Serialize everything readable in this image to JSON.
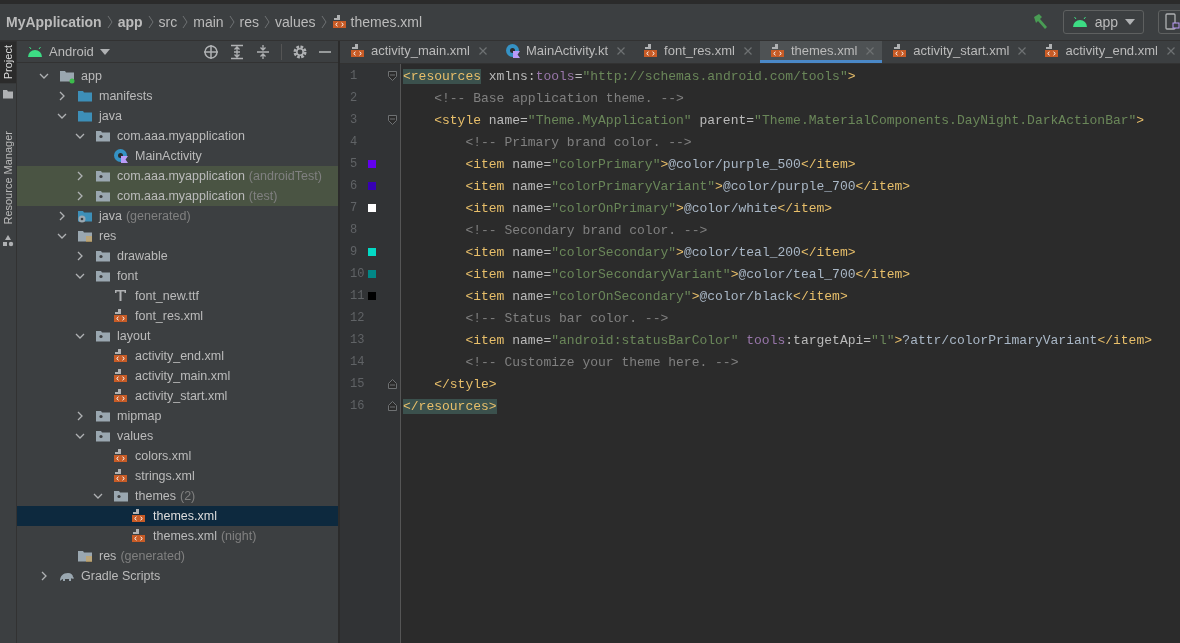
{
  "breadcrumb": [
    {
      "label": "MyApplication",
      "kind": "bold"
    },
    {
      "label": "app",
      "kind": "bold"
    },
    {
      "label": "src",
      "kind": "plain"
    },
    {
      "label": "main",
      "kind": "plain"
    },
    {
      "label": "res",
      "kind": "plain"
    },
    {
      "label": "values",
      "kind": "plain"
    },
    {
      "label": "themes.xml",
      "kind": "xml"
    }
  ],
  "run_config": {
    "label": "app"
  },
  "tool_strip": [
    {
      "label": "Project",
      "selected": true
    },
    {
      "label": "Resource Manager",
      "selected": false
    }
  ],
  "project_panel": {
    "view": "Android",
    "tree": [
      {
        "label": "app",
        "kind": "module",
        "expanded": true,
        "selected": false,
        "highlighted": false,
        "children": [
          {
            "label": "manifests",
            "kind": "folder",
            "expanded": false,
            "selected": false,
            "highlighted": false
          },
          {
            "label": "java",
            "kind": "folder",
            "expanded": true,
            "selected": false,
            "highlighted": false,
            "children": [
              {
                "label": "com.aaa.myapplication",
                "kind": "package",
                "expanded": true,
                "selected": false,
                "highlighted": false,
                "children": [
                  {
                    "label": "MainActivity",
                    "kind": "kotlin",
                    "selected": false,
                    "highlighted": false
                  }
                ]
              },
              {
                "label": "com.aaa.myapplication",
                "note": "(androidTest)",
                "kind": "package",
                "expanded": false,
                "selected": false,
                "highlighted": true
              },
              {
                "label": "com.aaa.myapplication",
                "note": "(test)",
                "kind": "package",
                "expanded": false,
                "selected": false,
                "highlighted": true
              }
            ]
          },
          {
            "label": "java",
            "note": "(generated)",
            "kind": "generated",
            "expanded": false,
            "selected": false,
            "highlighted": false
          },
          {
            "label": "res",
            "kind": "res",
            "expanded": true,
            "selected": false,
            "highlighted": false,
            "children": [
              {
                "label": "drawable",
                "kind": "package",
                "expanded": false,
                "selected": false,
                "highlighted": false
              },
              {
                "label": "font",
                "kind": "package",
                "expanded": true,
                "selected": false,
                "highlighted": false,
                "children": [
                  {
                    "label": "font_new.ttf",
                    "kind": "font",
                    "selected": false,
                    "highlighted": false
                  },
                  {
                    "label": "font_res.xml",
                    "kind": "xml",
                    "selected": false,
                    "highlighted": false
                  }
                ]
              },
              {
                "label": "layout",
                "kind": "package",
                "expanded": true,
                "selected": false,
                "highlighted": false,
                "children": [
                  {
                    "label": "activity_end.xml",
                    "kind": "xml",
                    "selected": false,
                    "highlighted": false
                  },
                  {
                    "label": "activity_main.xml",
                    "kind": "xml",
                    "selected": false,
                    "highlighted": false
                  },
                  {
                    "label": "activity_start.xml",
                    "kind": "xml",
                    "selected": false,
                    "highlighted": false
                  }
                ]
              },
              {
                "label": "mipmap",
                "kind": "package",
                "expanded": false,
                "selected": false,
                "highlighted": false
              },
              {
                "label": "values",
                "kind": "package",
                "expanded": true,
                "selected": false,
                "highlighted": false,
                "children": [
                  {
                    "label": "colors.xml",
                    "kind": "xml",
                    "selected": false,
                    "highlighted": false
                  },
                  {
                    "label": "strings.xml",
                    "kind": "xml",
                    "selected": false,
                    "highlighted": false
                  },
                  {
                    "label": "themes",
                    "note": "(2)",
                    "kind": "package",
                    "expanded": true,
                    "selected": false,
                    "highlighted": false,
                    "children": [
                      {
                        "label": "themes.xml",
                        "kind": "xml",
                        "selected": true,
                        "highlighted": false
                      },
                      {
                        "label": "themes.xml",
                        "note": "(night)",
                        "kind": "xml",
                        "selected": false,
                        "highlighted": false
                      }
                    ]
                  }
                ]
              }
            ]
          },
          {
            "label": "res",
            "note": "(generated)",
            "kind": "res",
            "selected": false,
            "highlighted": false
          }
        ]
      },
      {
        "label": "Gradle Scripts",
        "kind": "gradle",
        "expanded": false,
        "selected": false,
        "highlighted": false
      }
    ]
  },
  "editor": {
    "tabs": [
      {
        "label": "activity_main.xml",
        "kind": "xml",
        "selected": false
      },
      {
        "label": "MainActivity.kt",
        "kind": "kotlin",
        "selected": false
      },
      {
        "label": "font_res.xml",
        "kind": "xml",
        "selected": false
      },
      {
        "label": "themes.xml",
        "kind": "xml",
        "selected": true
      },
      {
        "label": "activity_start.xml",
        "kind": "xml",
        "selected": false
      },
      {
        "label": "activity_end.xml",
        "kind": "xml",
        "selected": false
      }
    ],
    "lines": [
      {
        "number": "1",
        "fold_start": true,
        "tokens": [
          {
            "kind": "match",
            "text": "<resources"
          },
          {
            "kind": "attr",
            "text": " xmlns:"
          },
          {
            "kind": "ns",
            "text": "tools"
          },
          {
            "kind": "attr",
            "text": "="
          },
          {
            "kind": "value",
            "text": "\"http://schemas.android.com/tools\""
          },
          {
            "kind": "tag",
            "text": ">"
          }
        ]
      },
      {
        "number": "2",
        "tokens": [
          {
            "kind": "comment",
            "text": "    <!-- Base application theme. -->"
          }
        ]
      },
      {
        "number": "3",
        "fold_start": true,
        "tokens": [
          {
            "kind": "tag",
            "text": "    <style"
          },
          {
            "kind": "attr",
            "text": " name="
          },
          {
            "kind": "value",
            "text": "\"Theme.MyApplication\""
          },
          {
            "kind": "attr",
            "text": " parent="
          },
          {
            "kind": "value",
            "text": "\"Theme.MaterialComponents.DayNight.DarkActionBar\""
          },
          {
            "kind": "tag",
            "text": ">"
          }
        ]
      },
      {
        "number": "4",
        "tokens": [
          {
            "kind": "comment",
            "text": "        <!-- Primary brand color. -->"
          }
        ]
      },
      {
        "number": "5",
        "color": "#6200ee",
        "tokens": [
          {
            "kind": "tag",
            "text": "        <item"
          },
          {
            "kind": "attr",
            "text": " name="
          },
          {
            "kind": "value",
            "text": "\"colorPrimary\""
          },
          {
            "kind": "tag",
            "text": ">"
          },
          {
            "kind": "text",
            "text": "@color/purple_500"
          },
          {
            "kind": "tag",
            "text": "</item>"
          }
        ]
      },
      {
        "number": "6",
        "color": "#3700b3",
        "tokens": [
          {
            "kind": "tag",
            "text": "        <item"
          },
          {
            "kind": "attr",
            "text": " name="
          },
          {
            "kind": "value",
            "text": "\"colorPrimaryVariant\""
          },
          {
            "kind": "tag",
            "text": ">"
          },
          {
            "kind": "text",
            "text": "@color/purple_700"
          },
          {
            "kind": "tag",
            "text": "</item>"
          }
        ]
      },
      {
        "number": "7",
        "color": "#ffffff",
        "tokens": [
          {
            "kind": "tag",
            "text": "        <item"
          },
          {
            "kind": "attr",
            "text": " name="
          },
          {
            "kind": "value",
            "text": "\"colorOnPrimary\""
          },
          {
            "kind": "tag",
            "text": ">"
          },
          {
            "kind": "text",
            "text": "@color/white"
          },
          {
            "kind": "tag",
            "text": "</item>"
          }
        ]
      },
      {
        "number": "8",
        "tokens": [
          {
            "kind": "comment",
            "text": "        <!-- Secondary brand color. -->"
          }
        ]
      },
      {
        "number": "9",
        "color": "#03dac5",
        "tokens": [
          {
            "kind": "tag",
            "text": "        <item"
          },
          {
            "kind": "attr",
            "text": " name="
          },
          {
            "kind": "value",
            "text": "\"colorSecondary\""
          },
          {
            "kind": "tag",
            "text": ">"
          },
          {
            "kind": "text",
            "text": "@color/teal_200"
          },
          {
            "kind": "tag",
            "text": "</item>"
          }
        ]
      },
      {
        "number": "10",
        "color": "#018786",
        "tokens": [
          {
            "kind": "tag",
            "text": "        <item"
          },
          {
            "kind": "attr",
            "text": " name="
          },
          {
            "kind": "value",
            "text": "\"colorSecondaryVariant\""
          },
          {
            "kind": "tag",
            "text": ">"
          },
          {
            "kind": "text",
            "text": "@color/teal_700"
          },
          {
            "kind": "tag",
            "text": "</item>"
          }
        ]
      },
      {
        "number": "11",
        "color": "#000000",
        "tokens": [
          {
            "kind": "tag",
            "text": "        <item"
          },
          {
            "kind": "attr",
            "text": " name="
          },
          {
            "kind": "value",
            "text": "\"colorOnSecondary\""
          },
          {
            "kind": "tag",
            "text": ">"
          },
          {
            "kind": "text",
            "text": "@color/black"
          },
          {
            "kind": "tag",
            "text": "</item>"
          }
        ]
      },
      {
        "number": "12",
        "tokens": [
          {
            "kind": "comment",
            "text": "        <!-- Status bar color. -->"
          }
        ]
      },
      {
        "number": "13",
        "tokens": [
          {
            "kind": "tag",
            "text": "        <item"
          },
          {
            "kind": "attr",
            "text": " name="
          },
          {
            "kind": "value",
            "text": "\"android:statusBarColor\""
          },
          {
            "kind": "ns",
            "text": " tools"
          },
          {
            "kind": "attr",
            "text": ":targetApi="
          },
          {
            "kind": "value",
            "text": "\"l\""
          },
          {
            "kind": "tag",
            "text": ">"
          },
          {
            "kind": "text",
            "text": "?attr/colorPrimaryVariant"
          },
          {
            "kind": "tag",
            "text": "</item>"
          }
        ]
      },
      {
        "number": "14",
        "tokens": [
          {
            "kind": "comment",
            "text": "        <!-- Customize your theme here. -->"
          }
        ]
      },
      {
        "number": "15",
        "fold_end": true,
        "tokens": [
          {
            "kind": "tag",
            "text": "    </style>"
          }
        ]
      },
      {
        "number": "16",
        "fold_end": true,
        "tokens": [
          {
            "kind": "match",
            "text": "</resources>"
          }
        ]
      }
    ]
  }
}
